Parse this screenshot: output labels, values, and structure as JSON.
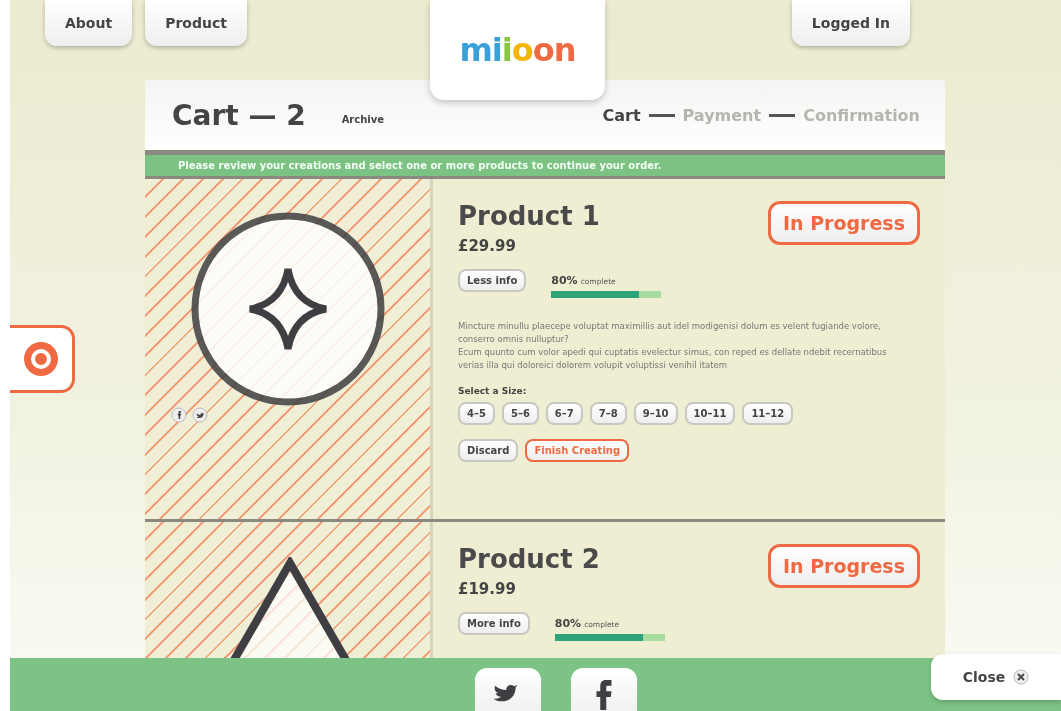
{
  "nav": {
    "left": [
      {
        "label": "About"
      },
      {
        "label": "Product"
      }
    ],
    "logo": "miioon",
    "right": {
      "label": "Logged In"
    }
  },
  "cart": {
    "title": "Cart — 2",
    "archive": "Archive",
    "steps": [
      {
        "label": "Cart",
        "active": true
      },
      {
        "label": "Payment",
        "active": false
      },
      {
        "label": "Confirmation",
        "active": false
      }
    ],
    "notice": "Please review your creations and select one or more products to continue your order."
  },
  "products": [
    {
      "kind": "circle-star",
      "name": "Product 1",
      "price": "£29.99",
      "status": "In Progress",
      "info_button": "Less info",
      "percent": "80%",
      "percent_label": "complete",
      "level": 0.8,
      "share": true,
      "description": [
        "Mincture minullu plaecepe voluptat maximillis aut idel modigenisi dolum es velent fugiande volore, conserro omnis nulluptur?",
        "Ecum quunto cum volor apedi qui cuptatis evelectur simus, con reped es dellate ndebit recernatibus verias illa qui doloreici dolorem volupit voluptissi venihil itatem"
      ],
      "size_label": "Select a Size:",
      "sizes": [
        "4–5",
        "5–6",
        "6–7",
        "7–8",
        "9–10",
        "10–11",
        "11–12"
      ],
      "actions": [
        {
          "label": "Discard",
          "kind": "plain"
        },
        {
          "label": "Finish Creating",
          "kind": "accent"
        }
      ]
    },
    {
      "kind": "triangle",
      "name": "Product 2",
      "price": "£19.99",
      "status": "In Progress",
      "info_button": "More info",
      "percent": "80%",
      "percent_label": "complete",
      "level": 0.8
    }
  ],
  "footer": {
    "close": "Close"
  }
}
